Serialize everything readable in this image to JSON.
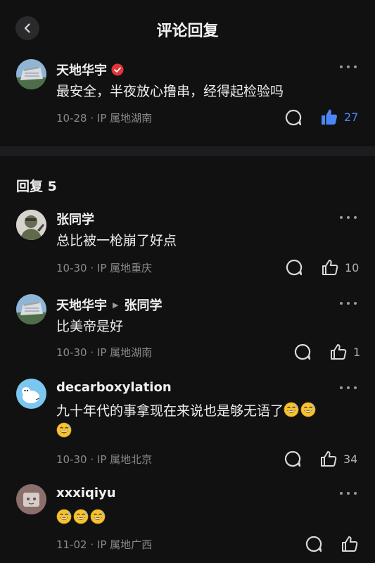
{
  "header": {
    "title": "评论回复"
  },
  "main_comment": {
    "author": "天地华宇",
    "text": "最安全，半夜放心撸串，经得起检验吗",
    "meta": "10-28 · IP 属地湖南",
    "likes": "27",
    "liked": true
  },
  "replies_section": {
    "title": "回复 5"
  },
  "replies": [
    {
      "author": "张同学",
      "text": "总比被一枪崩了好点",
      "meta": "10-30 · IP 属地重庆",
      "likes": "10"
    },
    {
      "author": "天地华宇",
      "reply_to": "张同学",
      "text": "比美帝是好",
      "meta": "10-30 · IP 属地湖南",
      "likes": "1"
    },
    {
      "author": "decarboxylation",
      "text": "九十年代的事拿现在来说也是够无语了",
      "emoji_count": 3,
      "meta": "10-30 · IP 属地北京",
      "likes": "34"
    },
    {
      "author": "xxxiqiyu",
      "text": "",
      "emoji_count": 3,
      "meta": "11-02 · IP 属地广西",
      "likes": ""
    }
  ],
  "colors": {
    "like_active": "#4a86f5",
    "background": "#111112",
    "meta": "#8a8a8e"
  },
  "icons": [
    "back-arrow-icon",
    "verified-icon",
    "more-icon",
    "comment-icon",
    "thumbs-up-icon",
    "sweat-smile-emoji"
  ]
}
